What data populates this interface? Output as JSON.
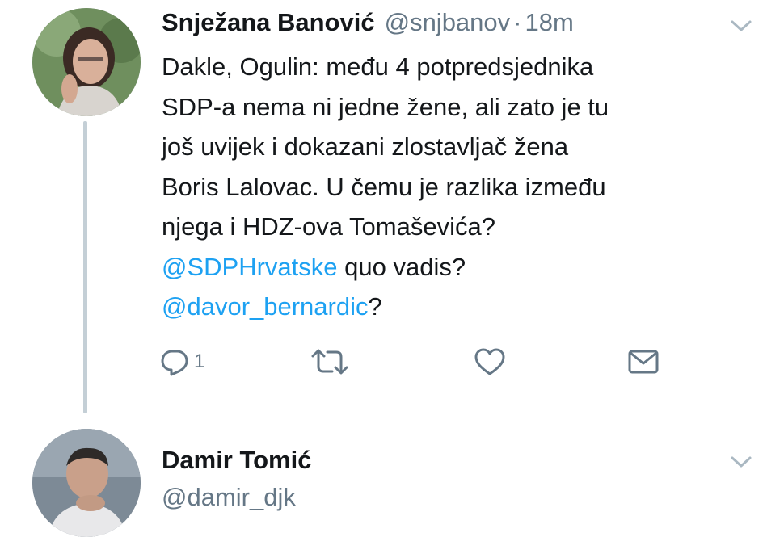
{
  "tweet1": {
    "name": "Snježana Banović",
    "handle": "@snjbanov",
    "separator": "·",
    "time": "18m",
    "lines": [
      "Dakle, Ogulin: među 4 potpredsjednika",
      "SDP-a nema ni jedne žene, ali zato je tu",
      "još uvijek i dokazani zlostavljač žena",
      "Boris Lalovac. U čemu je razlika između",
      "njega i HDZ-ova Tomaševića?"
    ],
    "mention1": "@SDPHrvatske",
    "mention1_suffix": " quo vadis?",
    "mention2": "@davor_bernardic",
    "mention2_suffix": "?",
    "reply_count": "1",
    "icons": {
      "reply": "reply-icon",
      "retweet": "retweet-icon",
      "like": "heart-icon",
      "dm": "envelope-icon",
      "more": "chevron-down-icon"
    }
  },
  "tweet2": {
    "name": "Damir Tomić",
    "handle": "@damir_djk"
  },
  "colors": {
    "link": "#1da1f2",
    "secondary": "#657786",
    "thread_line": "#c4cfd6"
  }
}
